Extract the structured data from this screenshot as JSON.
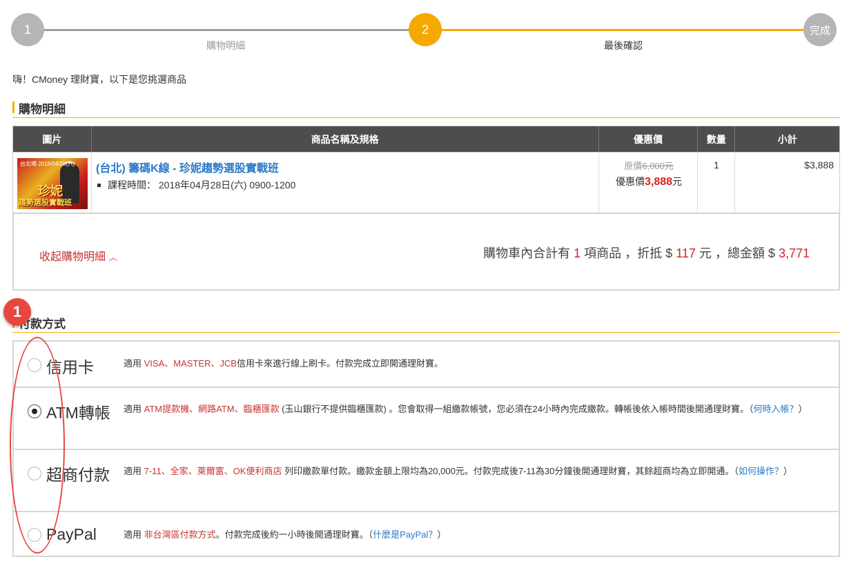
{
  "stepper": {
    "steps": [
      {
        "number": "1",
        "label": "購物明細"
      },
      {
        "number": "2",
        "label": "最後確認"
      },
      {
        "number": "完成",
        "label": ""
      }
    ]
  },
  "greeting": "嗨！CMoney 理財寶，以下是您挑選商品",
  "cart_section": {
    "title": "購物明細",
    "headers": [
      "圖片",
      "商品名稱及規格",
      "優惠價",
      "數量",
      "小計"
    ],
    "item": {
      "image_text_top": "台北場 2018/04/28(六)",
      "image_text_name": "珍妮",
      "image_text_bottom": "趨勢選股實戰班",
      "name": "(台北) 籌碼K線 - 珍妮趨勢選股實戰班",
      "time_label": "課程時間：",
      "time_value": "2018年04月28日(六) 0900-1200",
      "orig_price_prefix": "原價",
      "orig_price": "6,000元",
      "sale_prefix": "優惠價",
      "sale_price": "3,888",
      "sale_unit": "元",
      "qty": "1",
      "subtotal": "$3,888"
    },
    "collapse_label": "收起購物明細",
    "summary": {
      "part1": "購物車內合計有",
      "count": "1",
      "part2": "項商品 ，折抵 $",
      "discount": "117",
      "part3": "元 ，總金額 $",
      "total": "3,771"
    }
  },
  "payment_section": {
    "title": "付款方式",
    "options": [
      {
        "label": "信用卡",
        "checked": false,
        "desc_a": "適用 ",
        "desc_red": "VISA、MASTER、JCB",
        "desc_b": "信用卡來進行線上刷卡。付款完成立即開通理財寶。"
      },
      {
        "label": "ATM轉帳",
        "checked": true,
        "desc_a": "適用 ",
        "desc_red": "ATM提款機、網路ATM、臨櫃匯款",
        "desc_b": " (玉山銀行不提供臨櫃匯款) 。您會取得一組繳款帳號，您必須在24小時內完成繳款。轉帳後依入帳時間後開通理財寶。（",
        "desc_link": "何時入帳？",
        "desc_c": "）"
      },
      {
        "label": "超商付款",
        "checked": false,
        "desc_a": "適用 ",
        "desc_red": "7-11、全家、萊爾富、OK便利商店",
        "desc_b": " 列印繳款單付款。繳款金額上限均為20,000元。付款完成後7-11為30分鐘後開通理財寶，其餘超商均為立即開通。（",
        "desc_link": "如何操作？",
        "desc_c": "）"
      },
      {
        "label": "PayPal",
        "checked": false,
        "desc_a": "適用 ",
        "desc_red": "非台灣區付款方式",
        "desc_b": "。付款完成後約一小時後開通理財寶。（",
        "desc_link": "什麼是PayPal？",
        "desc_c": "）"
      }
    ]
  },
  "annotation": {
    "badge": "1"
  },
  "colors": {
    "accent": "#f5a800",
    "price_red": "#d42222",
    "link_blue": "#2a7ac8"
  }
}
